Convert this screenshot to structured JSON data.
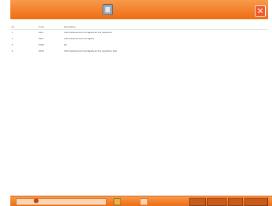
{
  "colors": {
    "accent": "#ef6c12",
    "accent_light": "#f79a4a",
    "close": "#f05a2a",
    "row_text": "#333333"
  },
  "window": {
    "title_icon": "document-icon",
    "close_icon": "close-icon",
    "close_glyph": "✕"
  },
  "table": {
    "headers": {
      "num": "No",
      "code": "Code",
      "desc": "Description"
    },
    "rows": [
      {
        "num": "1",
        "code": "0011",
        "desc": "Informational text not legible at this resolution"
      },
      {
        "num": "2",
        "code": "0017",
        "desc": "Informational text not legible"
      },
      {
        "num": "3",
        "code": "0030",
        "desc": "Ok"
      },
      {
        "num": "4",
        "code": "0033",
        "desc": "Informational text not legible at this resolution text"
      }
    ]
  },
  "statusbar": {
    "left_icon": "status-dot-icon",
    "lock_icon": "lock-icon",
    "seg1": "",
    "seg2": "",
    "seg3": "",
    "seg4": ""
  }
}
